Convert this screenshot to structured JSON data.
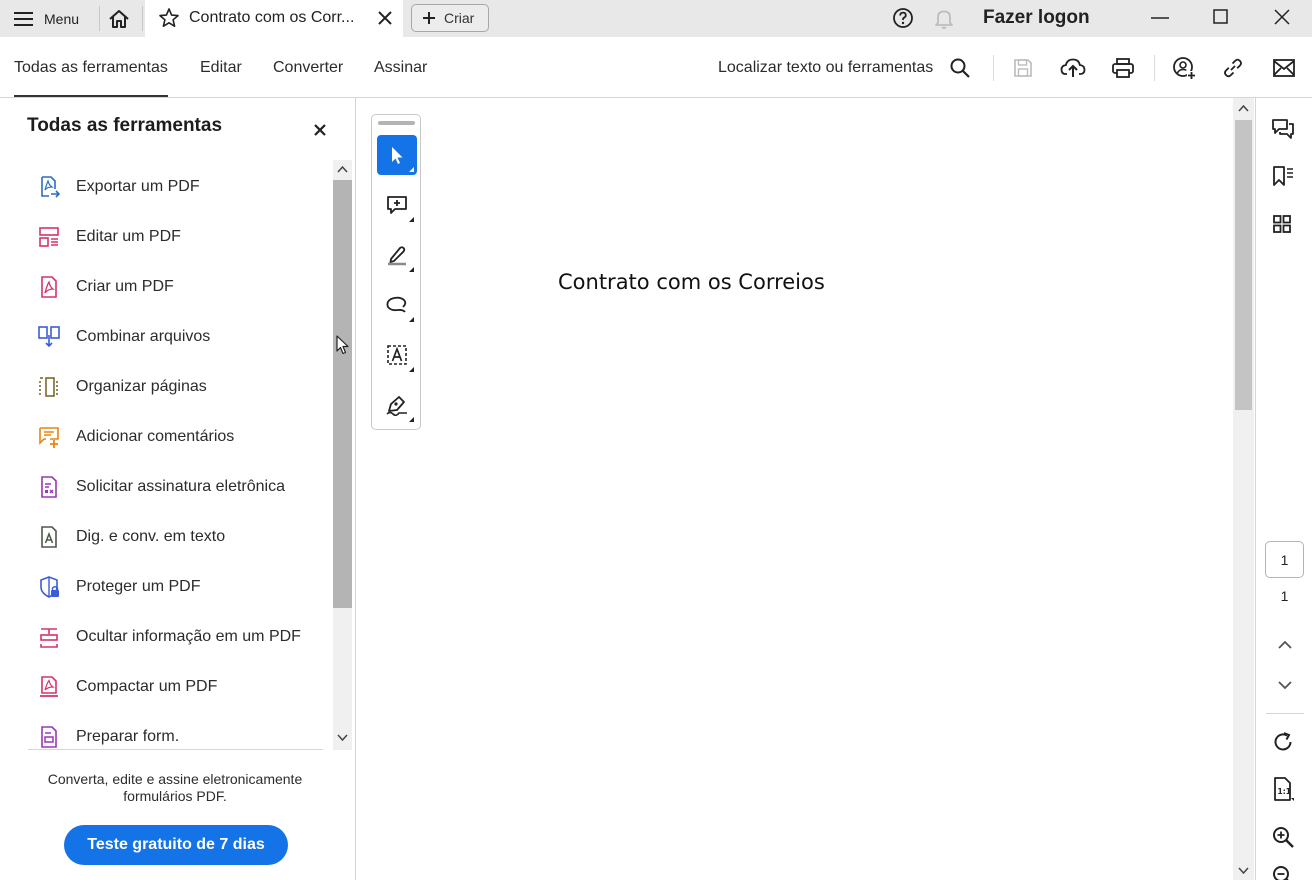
{
  "titlebar": {
    "menu_label": "Menu",
    "tab_title": "Contrato com os Corr...",
    "create_label": "Criar",
    "login_label": "Fazer logon"
  },
  "toolbar": {
    "tabs": [
      {
        "label": "Todas as ferramentas",
        "active": true
      },
      {
        "label": "Editar",
        "active": false
      },
      {
        "label": "Converter",
        "active": false
      },
      {
        "label": "Assinar",
        "active": false
      }
    ],
    "search_label": "Localizar texto ou ferramentas",
    "icons": [
      "search-icon",
      "save-icon",
      "cloud-upload-icon",
      "print-icon",
      "share-user-icon",
      "link-icon",
      "email-icon"
    ]
  },
  "tools_panel": {
    "title": "Todas as ferramentas",
    "items": [
      {
        "label": "Exportar um PDF",
        "icon": "export-pdf-icon",
        "color": "#2b6cc4"
      },
      {
        "label": "Editar um PDF",
        "icon": "edit-pdf-icon",
        "color": "#d6336c"
      },
      {
        "label": "Criar um PDF",
        "icon": "create-pdf-icon",
        "color": "#d6336c"
      },
      {
        "label": "Combinar arquivos",
        "icon": "combine-files-icon",
        "color": "#3b5bdb"
      },
      {
        "label": "Organizar páginas",
        "icon": "organize-pages-icon",
        "color": "#7a6a2e"
      },
      {
        "label": "Adicionar comentários",
        "icon": "add-comment-icon",
        "color": "#e8870e"
      },
      {
        "label": "Solicitar assinatura eletrônica",
        "icon": "request-signature-icon",
        "color": "#9c36b5"
      },
      {
        "label": "Dig. e conv. em texto",
        "icon": "scan-ocr-icon",
        "color": "#4a5a4a"
      },
      {
        "label": "Proteger um PDF",
        "icon": "protect-pdf-icon",
        "color": "#3b5bdb"
      },
      {
        "label": "Ocultar informação em um PDF",
        "icon": "redact-icon",
        "color": "#d6336c"
      },
      {
        "label": "Compactar um PDF",
        "icon": "compress-pdf-icon",
        "color": "#d6336c"
      },
      {
        "label": "Preparar form.",
        "icon": "prepare-form-icon",
        "color": "#9c36b5"
      }
    ],
    "promo_text": "Converta, edite e assine eletronicamente formulários PDF.",
    "trial_button": "Teste gratuito de 7 dias"
  },
  "document": {
    "text": "Contrato com os Correios"
  },
  "quick_tools": [
    "select-icon",
    "add-comment-icon",
    "highlight-icon",
    "draw-freeform-icon",
    "text-select-icon",
    "sign-icon"
  ],
  "right_rail": {
    "icons": [
      "comments-icon",
      "bookmarks-icon",
      "thumbnails-icon"
    ],
    "current_page": "1",
    "total_pages": "1",
    "bottom_icons": [
      "page-up-icon",
      "page-down-icon",
      "rotate-icon",
      "actual-size-icon",
      "zoom-in-icon",
      "zoom-out-icon"
    ]
  },
  "colors": {
    "accent": "#1473e6",
    "titlebar_bg": "#e8e8e8"
  }
}
